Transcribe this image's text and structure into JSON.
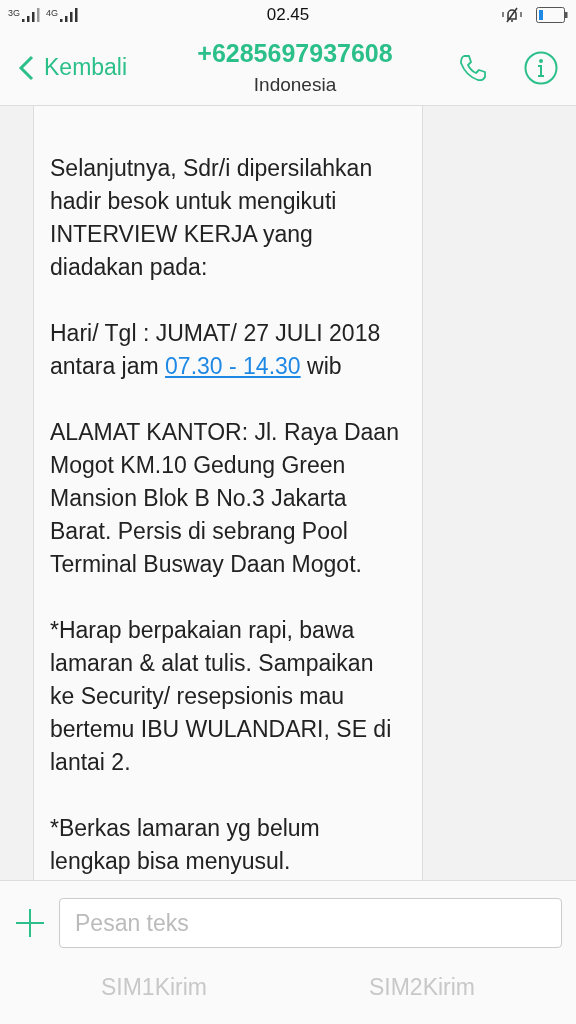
{
  "status_bar": {
    "network_1": "3G",
    "network_2": "4G",
    "time": "02.45"
  },
  "header": {
    "back_label": "Kembali",
    "title": "+6285697937608",
    "subtitle": "Indonesia"
  },
  "message": {
    "paragraphs": [
      {
        "kind": "plain",
        "text": "Selanjutnya, Sdr/i dipersilahkan\nhadir besok untuk mengikuti\nINTERVIEW KERJA yang\ndiadakan pada:"
      },
      {
        "kind": "linked",
        "before": "Hari/ Tgl : JUMAT/ 27 JULI 2018\nantara jam ",
        "link": "07.30 - 14.30",
        "after": " wib"
      },
      {
        "kind": "plain",
        "text": "ALAMAT KANTOR: Jl. Raya Daan\nMogot KM.10 Gedung Green\nMansion Blok B No.3 Jakarta\nBarat. Persis di sebrang Pool\nTerminal Busway Daan Mogot."
      },
      {
        "kind": "plain",
        "text": "*Harap berpakaian rapi, bawa\nlamaran & alat tulis. Sampaikan\nke Security/ resepsionis mau\nbertemu IBU WULANDARI, SE di\nlantai 2."
      },
      {
        "kind": "plain",
        "text": "*Berkas lamaran yg belum\nlengkap bisa menyusul."
      }
    ]
  },
  "composer": {
    "placeholder": "Pesan teks",
    "send_buttons": [
      "SIM1Kirim",
      "SIM2Kirim"
    ]
  }
}
